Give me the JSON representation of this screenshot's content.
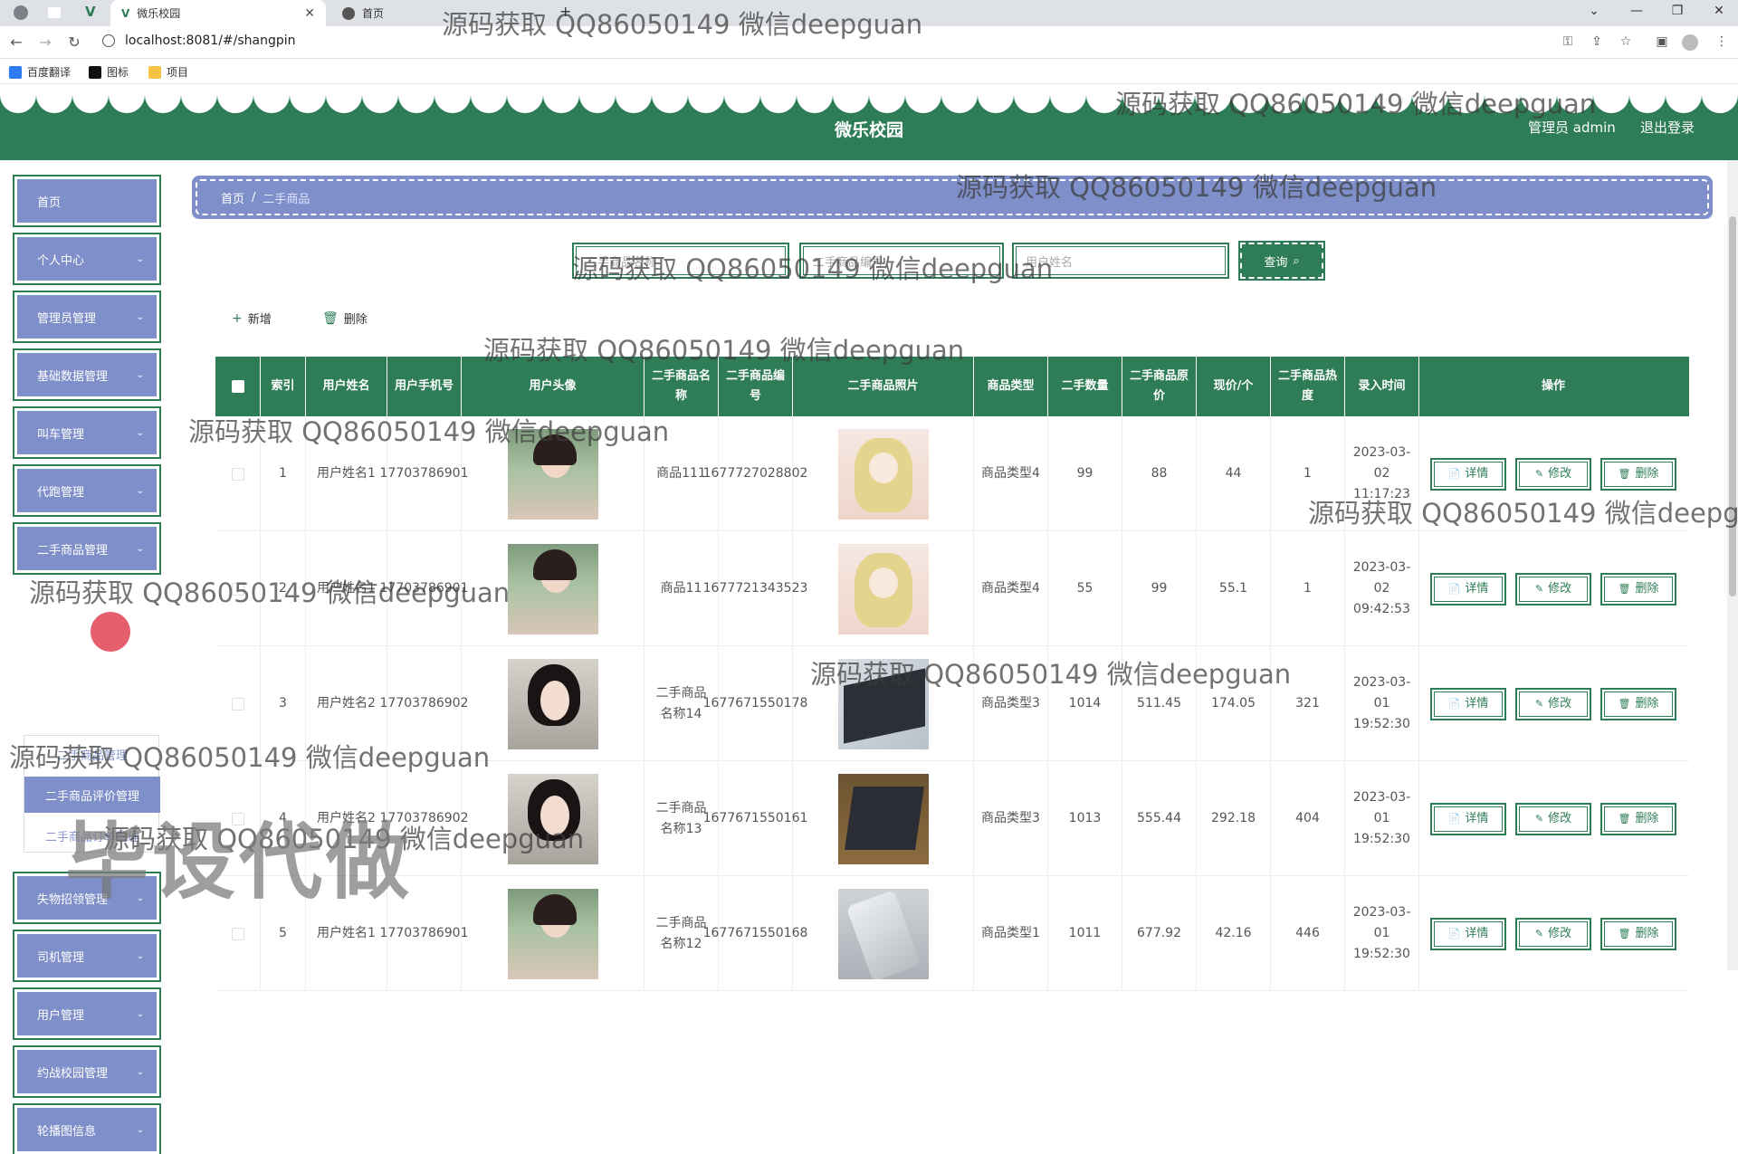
{
  "browser": {
    "tabs": [
      {
        "label": "微乐校园",
        "active": true
      },
      {
        "label": "首页",
        "active": false
      }
    ],
    "url": "localhost:8081/#/shangpin",
    "bookmarks": [
      {
        "label": "百度翻译",
        "color": "#2f7bf5"
      },
      {
        "label": "图标",
        "color": "#111111"
      },
      {
        "label": "项目",
        "color": "#f5c242"
      }
    ]
  },
  "header": {
    "title": "微乐校园",
    "user_label": "管理员 admin",
    "logout_label": "退出登录",
    "brand_color": "#2e7d57"
  },
  "sidebar": {
    "items": [
      {
        "label": "首页",
        "has_chevron": false
      },
      {
        "label": "个人中心",
        "has_chevron": true
      },
      {
        "label": "管理员管理",
        "has_chevron": true
      },
      {
        "label": "基础数据管理",
        "has_chevron": true
      },
      {
        "label": "叫车管理",
        "has_chevron": true
      },
      {
        "label": "代跑管理",
        "has_chevron": true
      },
      {
        "label": "二手商品管理",
        "has_chevron": true
      },
      {
        "label": "失物招领管理",
        "has_chevron": true
      },
      {
        "label": "司机管理",
        "has_chevron": true
      },
      {
        "label": "用户管理",
        "has_chevron": true
      },
      {
        "label": "约战校园管理",
        "has_chevron": true
      },
      {
        "label": "轮播图信息",
        "has_chevron": true
      }
    ],
    "submenu": [
      {
        "label": "二手商品管理",
        "active": false
      },
      {
        "label": "二手商品评价管理",
        "active": true
      },
      {
        "label": "二手商品订单管理",
        "active": false
      }
    ],
    "accent_color": "#7f8fc9"
  },
  "breadcrumb": {
    "home": "首页",
    "separator": "/",
    "current": "二手商品"
  },
  "search": {
    "fields": [
      {
        "placeholder": "二手商品名称"
      },
      {
        "placeholder": "二手商品编号"
      },
      {
        "placeholder": "用户姓名"
      }
    ],
    "button_label": "查询"
  },
  "actions": {
    "add_label": "新增",
    "delete_label": "删除"
  },
  "table": {
    "headers": [
      "",
      "索引",
      "用户姓名",
      "用户手机号",
      "用户头像",
      "二手商品名称",
      "二手商品编号",
      "二手商品照片",
      "商品类型",
      "二手数量",
      "二手商品原价",
      "现价/个",
      "二手商品热度",
      "录入时间",
      "操作"
    ],
    "rows": [
      {
        "index": "1",
        "user_name": "用户姓名1",
        "phone": "17703786901",
        "avatar": "girl",
        "name": "商品111",
        "code": "1677727028802",
        "image": "anime",
        "type": "商品类型4",
        "qty": "99",
        "orig_price": "88",
        "price": "44",
        "heat": "1",
        "time": "2023-03-02 11:17:23"
      },
      {
        "index": "2",
        "user_name": "用户姓名1",
        "phone": "17703786901",
        "avatar": "girl",
        "name": "商品11",
        "code": "1677721343523",
        "image": "anime",
        "type": "商品类型4",
        "qty": "55",
        "orig_price": "99",
        "price": "55.1",
        "heat": "1",
        "time": "2023-03-02 09:42:53"
      },
      {
        "index": "3",
        "user_name": "用户姓名2",
        "phone": "17703786902",
        "avatar": "star",
        "name": "二手商品名称14",
        "code": "1677671550178",
        "image": "laptop1",
        "type": "商品类型3",
        "qty": "1014",
        "orig_price": "511.45",
        "price": "174.05",
        "heat": "321",
        "time": "2023-03-01 19:52:30"
      },
      {
        "index": "4",
        "user_name": "用户姓名2",
        "phone": "17703786902",
        "avatar": "star",
        "name": "二手商品名称13",
        "code": "1677671550161",
        "image": "laptop2",
        "type": "商品类型3",
        "qty": "1013",
        "orig_price": "555.44",
        "price": "292.18",
        "heat": "404",
        "time": "2023-03-01 19:52:30"
      },
      {
        "index": "5",
        "user_name": "用户姓名1",
        "phone": "17703786901",
        "avatar": "girl",
        "name": "二手商品名称12",
        "code": "1677671550168",
        "image": "phone",
        "type": "商品类型1",
        "qty": "1011",
        "orig_price": "677.92",
        "price": "42.16",
        "heat": "446",
        "time": "2023-03-01 19:52:30"
      }
    ],
    "op_labels": {
      "detail": "详情",
      "edit": "修改",
      "delete": "删除"
    }
  },
  "watermarks": {
    "contact": "源码获取 QQ86050149 微信deepguan",
    "big": "毕设代做"
  }
}
